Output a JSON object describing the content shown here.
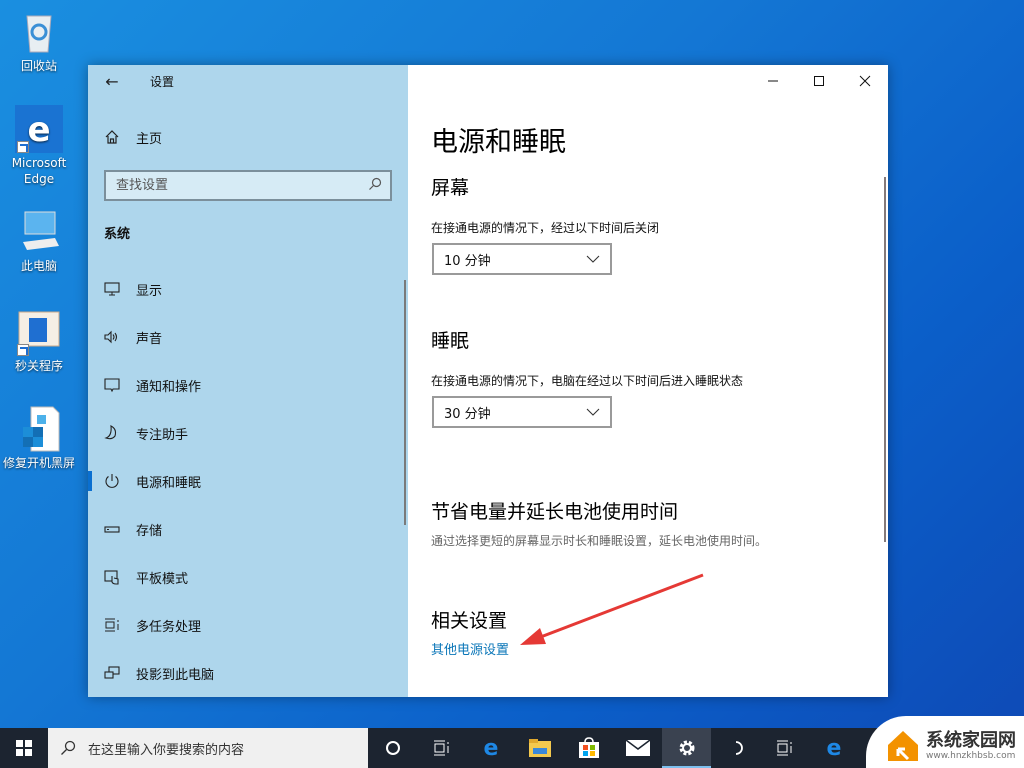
{
  "desktop": {
    "icons": [
      {
        "name": "recycle-bin",
        "label": "回收站"
      },
      {
        "name": "microsoft-edge",
        "label": "Microsoft Edge"
      },
      {
        "name": "this-pc",
        "label": "此电脑"
      },
      {
        "name": "shutdown-program",
        "label": "秒关程序"
      },
      {
        "name": "fix-black-screen",
        "label": "修复开机黑屏"
      }
    ]
  },
  "settings": {
    "title": "设置",
    "home": "主页",
    "search_placeholder": "查找设置",
    "section": "系统",
    "nav": [
      {
        "label": "显示",
        "icon": "monitor-icon"
      },
      {
        "label": "声音",
        "icon": "speaker-icon"
      },
      {
        "label": "通知和操作",
        "icon": "notification-icon"
      },
      {
        "label": "专注助手",
        "icon": "moon-icon"
      },
      {
        "label": "电源和睡眠",
        "icon": "power-icon",
        "active": true
      },
      {
        "label": "存储",
        "icon": "storage-icon"
      },
      {
        "label": "平板模式",
        "icon": "tablet-mode-icon"
      },
      {
        "label": "多任务处理",
        "icon": "multitasking-icon"
      },
      {
        "label": "投影到此电脑",
        "icon": "project-icon"
      }
    ],
    "content": {
      "page_title": "电源和睡眠",
      "screen": {
        "heading": "屏幕",
        "desc": "在接通电源的情况下，经过以下时间后关闭",
        "value": "10 分钟"
      },
      "sleep": {
        "heading": "睡眠",
        "desc": "在接通电源的情况下，电脑在经过以下时间后进入睡眠状态",
        "value": "30 分钟"
      },
      "battery": {
        "heading": "节省电量并延长电池使用时间",
        "desc": "通过选择更短的屏幕显示时长和睡眠设置，延长电池使用时间。"
      },
      "related": {
        "heading": "相关设置",
        "link": "其他电源设置"
      }
    }
  },
  "taskbar": {
    "search_placeholder": "在这里输入你要搜索的内容",
    "active_app": "settings"
  },
  "watermark": {
    "title": "系统家园网",
    "url": "www.hnzkhbsb.com"
  },
  "colors": {
    "accent": "#0a6fd0",
    "link": "#0a76b8",
    "sidebar_bg": "#aed6ec",
    "arrow": "#e53935"
  }
}
